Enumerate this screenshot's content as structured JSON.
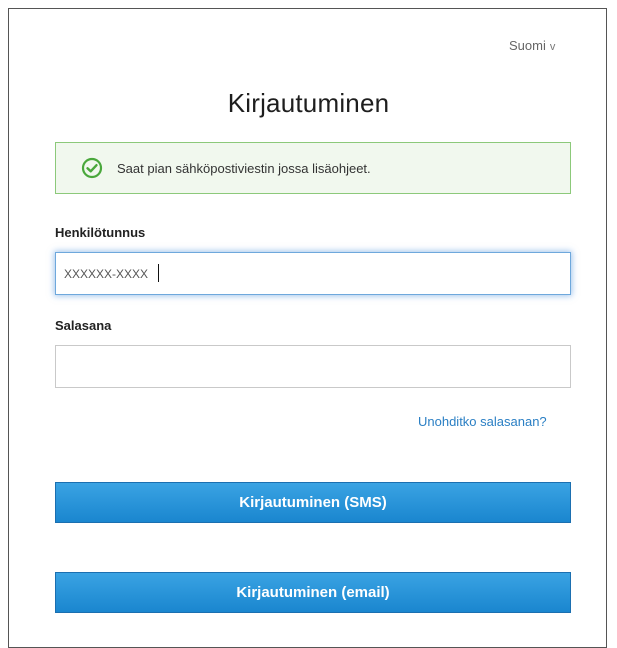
{
  "language": {
    "label": "Suomi",
    "chevron": "v"
  },
  "page_title": "Kirjautuminen",
  "alert": {
    "icon": "check-circle-icon",
    "message": "Saat pian sähköpostiviestin jossa lisäohjeet.",
    "border_color": "#8cc97a",
    "background_color": "#f1f8ee"
  },
  "form": {
    "id_label": "Henkilötunnus",
    "id_value": "XXXXXX-XXXX",
    "password_label": "Salasana",
    "password_value": "",
    "forgot_link": "Unohditko salasanan?"
  },
  "buttons": {
    "sms_label": "Kirjautuminen (SMS)",
    "email_label": "Kirjautuminen (email)",
    "color": "#1a86cf"
  }
}
